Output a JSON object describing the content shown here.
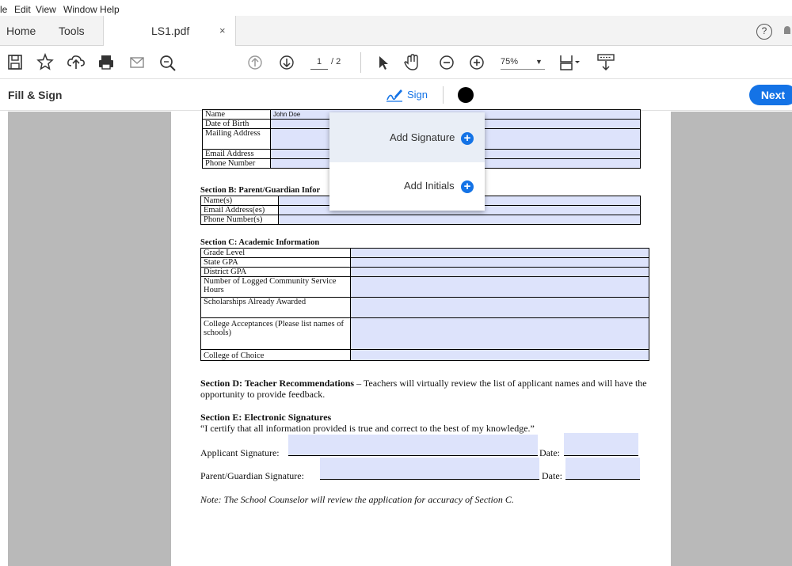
{
  "menu": [
    "le",
    "Edit",
    "View",
    "Window",
    "Help"
  ],
  "tabs": {
    "home": "Home",
    "tools": "Tools",
    "document": "LS1.pdf",
    "close": "×"
  },
  "help_glyph": "?",
  "toolbar": {
    "page_current": "1",
    "page_total": "/ 2",
    "zoom": "75%"
  },
  "fill_sign": {
    "title": "Fill & Sign",
    "sign_label": "Sign",
    "next_label": "Next",
    "ink_color": "#000000"
  },
  "popup": {
    "add_signature": "Add Signature",
    "add_initials": "Add Initials"
  },
  "form": {
    "section_a_rows": [
      {
        "label": "Name",
        "value": "John Doe"
      },
      {
        "label": "Date of Birth",
        "value": ""
      },
      {
        "label": "Mailing Address",
        "value": ""
      },
      {
        "label": "Email Address",
        "value": ""
      },
      {
        "label": "Phone Number",
        "value": ""
      }
    ],
    "section_b_title": "Section B: Parent/Guardian Infor",
    "section_b_rows": [
      "Name(s)",
      "Email Address(es)",
      "Phone Number(s)"
    ],
    "section_c_title": "Section C: Academic Information",
    "section_c_rows": [
      "Grade Level",
      "State GPA",
      "District GPA",
      "Number of Logged Community Service Hours",
      "Scholarships Already Awarded",
      "College Acceptances (Please list names of schools)",
      "College of Choice"
    ],
    "section_d_title": "Section D: Teacher Recommendations",
    "section_d_text": " – Teachers will virtually review the list of applicant names and will have the opportunity to provide feedback.",
    "section_e_title": "Section E: Electronic Signatures",
    "section_e_text": "“I certify that all information provided is true and correct to the best of my knowledge.”",
    "applicant_signature": "Applicant Signature:",
    "parent_signature": "Parent/Guardian Signature:",
    "date_label": "Date:",
    "note": "Note: The School Counselor will review the application for accuracy of Section C."
  },
  "colors": {
    "accent": "#1473e6",
    "field_fill": "#dde3fb",
    "viewer_bg": "#b9b9b9"
  }
}
